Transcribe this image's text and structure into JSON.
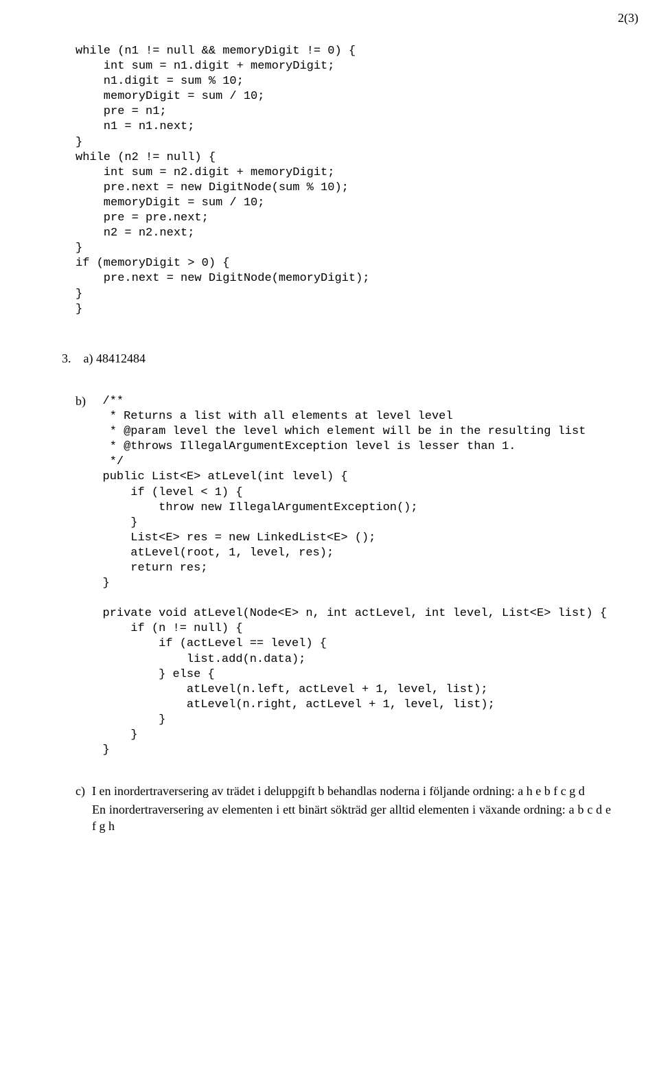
{
  "page_number": "2(3)",
  "code1": "while (n1 != null && memoryDigit != 0) {\n    int sum = n1.digit + memoryDigit;\n    n1.digit = sum % 10;\n    memoryDigit = sum / 10;\n    pre = n1;\n    n1 = n1.next;\n}\nwhile (n2 != null) {\n    int sum = n2.digit + memoryDigit;\n    pre.next = new DigitNode(sum % 10);\n    memoryDigit = sum / 10;\n    pre = pre.next;\n    n2 = n2.next;\n}\nif (memoryDigit > 0) {\n    pre.next = new DigitNode(memoryDigit);\n}\n}",
  "q3_label": "3.",
  "q3a_label": "a)",
  "q3a_value": "48412484",
  "q3b_label": "b)",
  "code2": "/**\n * Returns a list with all elements at level level\n * @param level the level which element will be in the resulting list\n * @throws IllegalArgumentException level is lesser than 1.\n */\npublic List<E> atLevel(int level) {\n    if (level < 1) {\n        throw new IllegalArgumentException();\n    }\n    List<E> res = new LinkedList<E> ();\n    atLevel(root, 1, level, res);\n    return res;\n}\n\nprivate void atLevel(Node<E> n, int actLevel, int level, List<E> list) {\n    if (n != null) {\n        if (actLevel == level) {\n            list.add(n.data);\n        } else {\n            atLevel(n.left, actLevel + 1, level, list);\n            atLevel(n.right, actLevel + 1, level, list);\n        }\n    }\n}",
  "q3c_label": "c)",
  "q3c_p1": "I en inordertraversering av trädet i deluppgift b behandlas noderna i följande ordning: a h e b f c g d",
  "q3c_p2": "En inordertraversering av elementen i ett binärt sökträd ger alltid elementen i växande ordning: a b c d e f g h"
}
